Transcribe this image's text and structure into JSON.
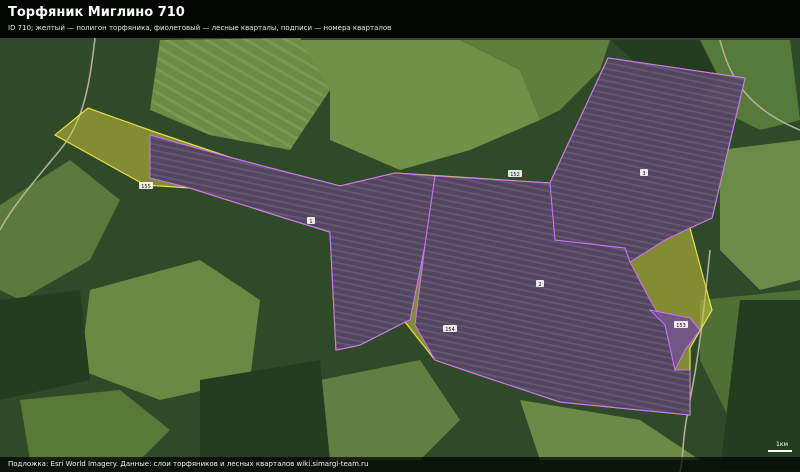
{
  "header": {
    "title": "Торфяник Миглино 710",
    "subtitle": "ID 710; желтый — полигон торфяника, фиолетовый — лесные кварталы, подписи — номера кварталов"
  },
  "footer": {
    "attribution": "Подложка: Esri World Imagery. Данные: слои торфяников и лесных кварталов wiki.simargl-team.ru"
  },
  "scale": {
    "label": "1км"
  },
  "legend_colors": {
    "peatland": "#e6e04a",
    "forest_quarter": "#b44dff"
  },
  "quarters": [
    {
      "id": "q-155",
      "label": "155"
    },
    {
      "id": "q-1",
      "label": "1"
    },
    {
      "id": "q-152",
      "label": "152"
    },
    {
      "id": "q-2",
      "label": "2"
    },
    {
      "id": "q-3",
      "label": "3"
    },
    {
      "id": "q-154",
      "label": "154"
    },
    {
      "id": "q-153",
      "label": "153"
    }
  ]
}
